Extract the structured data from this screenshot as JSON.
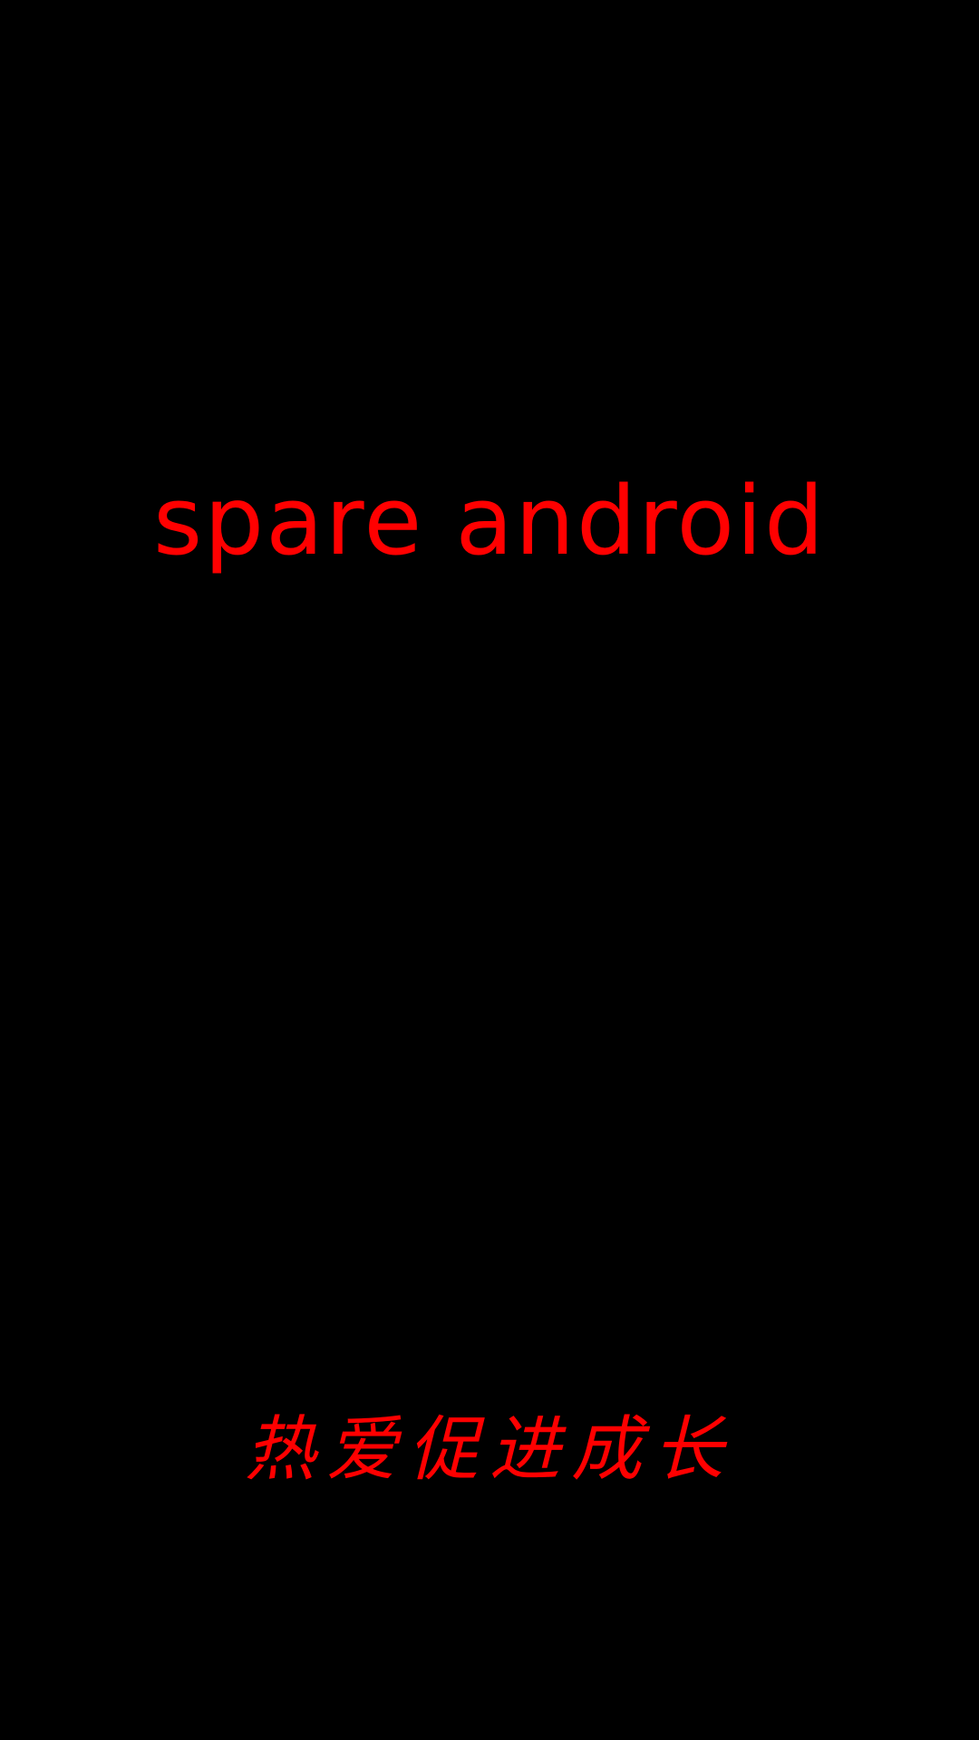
{
  "splash": {
    "app_name": "spare android",
    "slogan": "热爱促进成长"
  },
  "colors": {
    "background": "#000000",
    "text": "#ff0000"
  }
}
